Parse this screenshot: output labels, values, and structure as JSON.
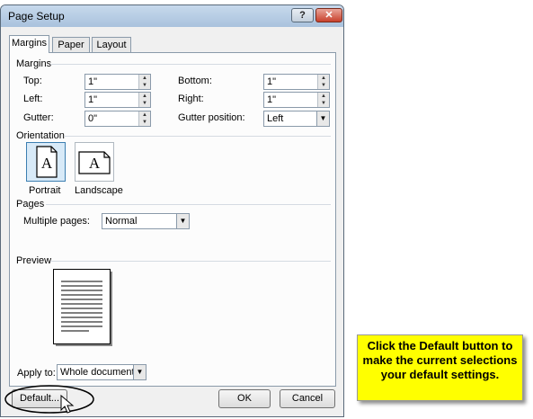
{
  "dialog": {
    "title": "Page Setup",
    "help_glyph": "?",
    "close_glyph": "✕",
    "tabs": [
      {
        "label": "Margins"
      },
      {
        "label": "Paper"
      },
      {
        "label": "Layout"
      }
    ],
    "margins": {
      "section": "Margins",
      "top_label": "Top:",
      "top_value": "1\"",
      "bottom_label": "Bottom:",
      "bottom_value": "1\"",
      "left_label": "Left:",
      "left_value": "1\"",
      "right_label": "Right:",
      "right_value": "1\"",
      "gutter_label": "Gutter:",
      "gutter_value": "0\"",
      "gutter_position_label": "Gutter position:",
      "gutter_position_value": "Left"
    },
    "orientation": {
      "section": "Orientation",
      "portrait_label": "Portrait",
      "landscape_label": "Landscape",
      "glyph": "A",
      "selected": "portrait"
    },
    "pages": {
      "section": "Pages",
      "multiple_pages_label": "Multiple pages:",
      "multiple_pages_value": "Normal"
    },
    "preview": {
      "section": "Preview"
    },
    "apply_to": {
      "label": "Apply to:",
      "value": "Whole document"
    },
    "buttons": {
      "default": "Default...",
      "ok": "OK",
      "cancel": "Cancel"
    }
  },
  "callout": {
    "line1": "Click the Default button to",
    "line2": "make the current selections",
    "line3": "your default settings."
  },
  "colors": {
    "callout_bg": "#ffff00",
    "selected_orientation_bg": "#d8eaf8",
    "close_button": "#c8402c"
  }
}
